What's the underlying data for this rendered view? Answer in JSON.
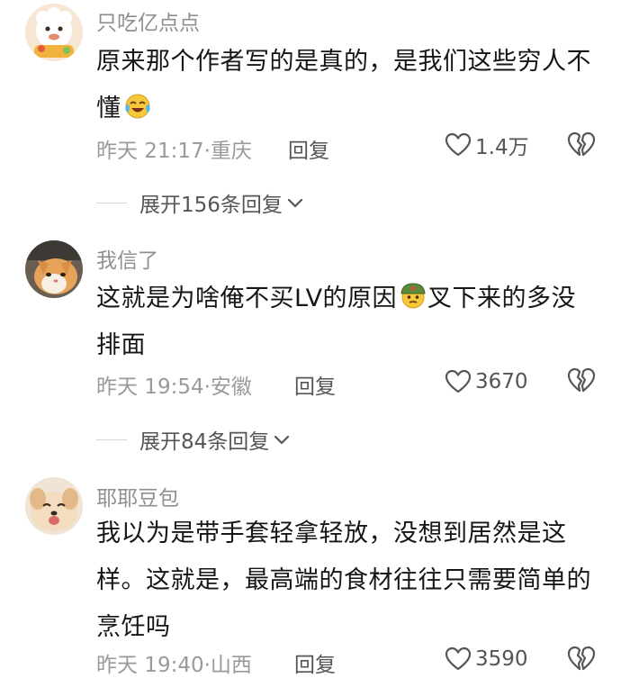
{
  "comments": [
    {
      "username": "只吃亿点点",
      "content": "原来那个作者写的是真的，是我们这些穷人不懂",
      "emoji": "tears-of-joy-emoji",
      "time": "昨天 21:17",
      "location": "重庆",
      "reply_label": "回复",
      "likes": "1.4万",
      "replies_label": "展开156条回复"
    },
    {
      "username": "我信了",
      "content_before": "这就是为啥俺不买LV的原因",
      "emoji": "soldier-thinking-emoji",
      "content_after": "叉下来的多没排面",
      "time": "昨天 19:54",
      "location": "安徽",
      "reply_label": "回复",
      "likes": "3670",
      "replies_label": "展开84条回复"
    },
    {
      "username": "耶耶豆包",
      "content": "我以为是带手套轻拿轻放，没想到居然是这样。这就是，最高端的食材往往只需要简单的烹饪吗",
      "time": "昨天 19:40",
      "location": "山西",
      "reply_label": "回复",
      "likes": "3590"
    }
  ],
  "colors": {
    "text": "#161616",
    "username": "#8f8f8f",
    "meta": "#9a9a9a",
    "action": "#555555"
  }
}
